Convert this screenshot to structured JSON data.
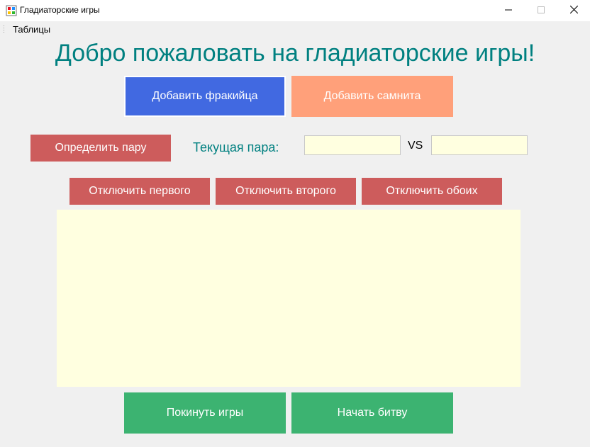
{
  "window": {
    "title": "Гладиаторские игры"
  },
  "menu": {
    "items": [
      "Таблицы"
    ]
  },
  "main": {
    "heading": "Добро пожаловать на гладиаторские игры!",
    "add_thracian_label": "Добавить фракийца",
    "add_samnite_label": "Добавить самнита",
    "determine_pair_label": "Определить пару",
    "current_pair_label": "Текущая пара:",
    "vs_label": "VS",
    "fighter1_value": "",
    "fighter2_value": "",
    "disable_first_label": "Отключить первого",
    "disable_second_label": "Отключить второго",
    "disable_both_label": "Отключить обоих",
    "log_value": "",
    "leave_games_label": "Покинуть игры",
    "start_battle_label": "Начать битву"
  },
  "colors": {
    "heading": "#008080",
    "add_thracian_button": "#4169e1",
    "add_samnite_button": "#ffa07a",
    "red_buttons": "#cd5c5c",
    "green_buttons": "#3cb371",
    "textbox_background": "#ffffe0"
  },
  "icons": {
    "app": "app-icon",
    "minimize": "minimize-icon",
    "maximize": "maximize-icon",
    "close": "close-icon",
    "menu_grip": "grip-icon"
  }
}
